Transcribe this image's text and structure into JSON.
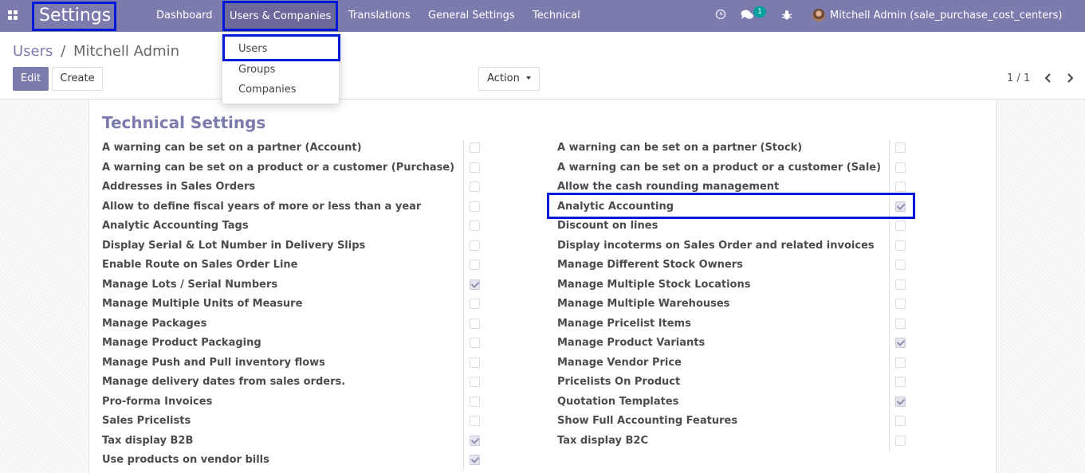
{
  "navbar": {
    "brand": "Settings",
    "menu": [
      "Dashboard",
      "Users & Companies",
      "Translations",
      "General Settings",
      "Technical"
    ],
    "active_menu": "Users & Companies",
    "chat_badge": "1",
    "user_name": "Mitchell Admin (sale_purchase_cost_centers)"
  },
  "dropdown": {
    "items": [
      "Users",
      "Groups",
      "Companies"
    ]
  },
  "breadcrumb": {
    "parent": "Users",
    "separator": "/",
    "current": "Mitchell Admin"
  },
  "buttons": {
    "edit": "Edit",
    "create": "Create",
    "action": "Action"
  },
  "pager": {
    "value": "1 / 1"
  },
  "section": {
    "title": "Technical Settings"
  },
  "settings_left": [
    {
      "label": "A warning can be set on a partner (Account)",
      "checked": false
    },
    {
      "label": "A warning can be set on a product or a customer (Purchase)",
      "checked": false
    },
    {
      "label": "Addresses in Sales Orders",
      "checked": false
    },
    {
      "label": "Allow to define fiscal years of more or less than a year",
      "checked": false
    },
    {
      "label": "Analytic Accounting Tags",
      "checked": false
    },
    {
      "label": "Display Serial & Lot Number in Delivery Slips",
      "checked": false
    },
    {
      "label": "Enable Route on Sales Order Line",
      "checked": false
    },
    {
      "label": "Manage Lots / Serial Numbers",
      "checked": true
    },
    {
      "label": "Manage Multiple Units of Measure",
      "checked": false
    },
    {
      "label": "Manage Packages",
      "checked": false
    },
    {
      "label": "Manage Product Packaging",
      "checked": false
    },
    {
      "label": "Manage Push and Pull inventory flows",
      "checked": false
    },
    {
      "label": "Manage delivery dates from sales orders.",
      "checked": false
    },
    {
      "label": "Pro-forma Invoices",
      "checked": false
    },
    {
      "label": "Sales Pricelists",
      "checked": false
    },
    {
      "label": "Tax display B2B",
      "checked": true
    },
    {
      "label": "Use products on vendor bills",
      "checked": true
    }
  ],
  "settings_right": [
    {
      "label": "A warning can be set on a partner (Stock)",
      "checked": false
    },
    {
      "label": "A warning can be set on a product or a customer (Sale)",
      "checked": false
    },
    {
      "label": "Allow the cash rounding management",
      "checked": false
    },
    {
      "label": "Analytic Accounting",
      "checked": true
    },
    {
      "label": "Discount on lines",
      "checked": false
    },
    {
      "label": "Display incoterms on Sales Order and related invoices",
      "checked": false
    },
    {
      "label": "Manage Different Stock Owners",
      "checked": false
    },
    {
      "label": "Manage Multiple Stock Locations",
      "checked": false
    },
    {
      "label": "Manage Multiple Warehouses",
      "checked": false
    },
    {
      "label": "Manage Pricelist Items",
      "checked": false
    },
    {
      "label": "Manage Product Variants",
      "checked": true
    },
    {
      "label": "Manage Vendor Price",
      "checked": false
    },
    {
      "label": "Pricelists On Product",
      "checked": false
    },
    {
      "label": "Quotation Templates",
      "checked": true
    },
    {
      "label": "Show Full Accounting Features",
      "checked": false
    },
    {
      "label": "Tax display B2C",
      "checked": false
    }
  ],
  "colors": {
    "brand": "#7c7bad",
    "highlight": "#0019d6",
    "badge": "#00a09d"
  }
}
